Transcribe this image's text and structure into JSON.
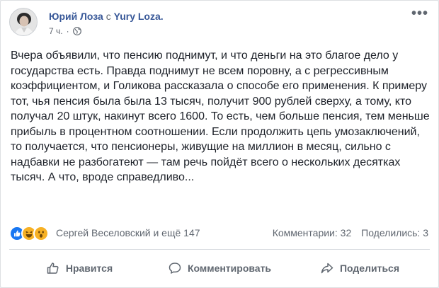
{
  "post": {
    "author": "Юрий Лоза",
    "with_word": "с",
    "page_name": "Yury Loza.",
    "time": "7 ч.",
    "privacy_icon": "globe-icon",
    "text": "Вчера объявили, что пенсию поднимут, и что деньги на это благое дело у государства есть. Правда поднимут не всем поровну, а с регрессивным коэффициентом, и Голикова рассказала о способе его применения. К примеру тот, чья пенсия была была 13 тысяч, получит 900 рублей сверху, а тому, кто получал 20 штук, накинут всего 1600. То есть, чем больше пенсия, тем меньше прибыль в процентном соотношении. Если продолжить цепь умозаключений, то получается, что пенсионеры, живущие на миллион в месяц, сильно с надбавки не разбогатеют — там речь пойдёт всего о нескольких десятках тысяч. А что, вроде справедливо..."
  },
  "reactions": {
    "icons": [
      "like-reaction-icon",
      "haha-reaction-icon",
      "wow-reaction-icon"
    ],
    "summary": "Сергей Веселовский и ещё 147",
    "comments": "Комментарии: 32",
    "shares": "Поделились: 3"
  },
  "actions": {
    "like": "Нравится",
    "comment": "Комментировать",
    "share": "Поделиться"
  },
  "colors": {
    "link": "#385898",
    "secondary": "#606770",
    "like_blue": "#1877f2",
    "emoji_yellow": "#f7b125"
  }
}
